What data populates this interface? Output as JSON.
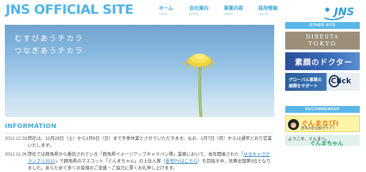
{
  "header": {
    "site_title": "JNS OFFICIAL SITE",
    "logo_text": "JNS",
    "nav": [
      {
        "jp": "ホーム",
        "en": "home"
      },
      {
        "jp": "会社案内",
        "en": "profile"
      },
      {
        "jp": "事業内容",
        "en": "works"
      },
      {
        "jp": "採用情報",
        "en": "recruit"
      }
    ]
  },
  "hero": {
    "line1": "むすびあうチカラ",
    "line2": "つなぎあうチカラ"
  },
  "info": {
    "title": "INFORMATION",
    "items": [
      {
        "date": "2012.12.28",
        "text": "弊社は、12月29日（土）から1月6日（日）まで冬季休業とさせていただきます。なお、1月7日（月）からは通常どおり営業いたします。"
      },
      {
        "date": "2012.11.26",
        "text_before": "弊社では群馬県から委託されている「群馬県イメージアップキャラバン隊」業務において、本年開催された「",
        "link1": "ゆるキャラグランプリ2012",
        "text_middle": "」で群馬県のマスコット「ぐんまちゃん」の上位入賞（",
        "link2": "参考PVはこちら",
        "text_after": "）を目指す中、見事全国第3位となりました。あらためて多くの皆様のご支援・ご協力に厚くお礼申し上げます。"
      }
    ]
  },
  "sidebar": {
    "other_site_label": "OTHER SITE",
    "banners": [
      {
        "line1": "DIRESTA",
        "line2": "TOKYO"
      },
      {
        "line1": "素顔のドクター"
      },
      {
        "line1": "グローバル事業の",
        "line2": "展開をサポート",
        "line3": "Click"
      }
    ],
    "recommended_label": "RECOMMENDED",
    "recommended": [
      {
        "line1": "ぐんまなび!",
        "line2": "群馬の総合観光サイト"
      },
      {
        "line1": "ようこそ、ぐんまへ。",
        "line2": "ぐんまちゃん"
      }
    ]
  },
  "colors": {
    "accent": "#4fb4e6",
    "nav_text": "#3aa6dc",
    "link": "#2a7fc1"
  }
}
